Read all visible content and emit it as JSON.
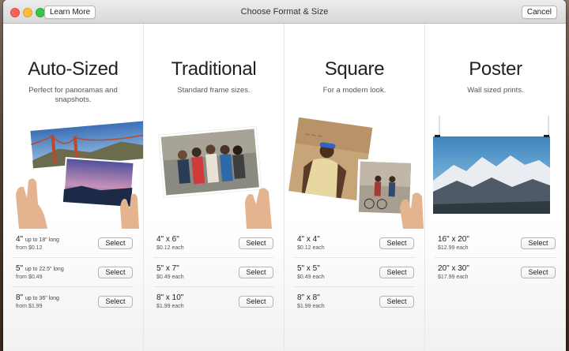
{
  "window": {
    "title": "Choose Format & Size",
    "learn_more_label": "Learn More",
    "cancel_label": "Cancel"
  },
  "columns": [
    {
      "title": "Auto-Sized",
      "subtitle": "Perfect for panoramas and snapshots.",
      "options": [
        {
          "size": "4\"",
          "size_note": "up to 18\" long",
          "price": "from $0.12",
          "button": "Select"
        },
        {
          "size": "5\"",
          "size_note": "up to 22.5\" long",
          "price": "from $0.49",
          "button": "Select"
        },
        {
          "size": "8\"",
          "size_note": "up to 36\" long",
          "price": "from $1.99",
          "button": "Select"
        }
      ]
    },
    {
      "title": "Traditional",
      "subtitle": "Standard frame sizes.",
      "options": [
        {
          "size": "4\" x 6\"",
          "price": "$0.12 each",
          "button": "Select"
        },
        {
          "size": "5\" x 7\"",
          "price": "$0.49 each",
          "button": "Select"
        },
        {
          "size": "8\" x 10\"",
          "price": "$1.99 each",
          "button": "Select"
        }
      ]
    },
    {
      "title": "Square",
      "subtitle": "For a modern look.",
      "options": [
        {
          "size": "4\" x 4\"",
          "price": "$0.12 each",
          "button": "Select"
        },
        {
          "size": "5\" x 5\"",
          "price": "$0.49 each",
          "button": "Select"
        },
        {
          "size": "8\" x 8\"",
          "price": "$1.99 each",
          "button": "Select"
        }
      ]
    },
    {
      "title": "Poster",
      "subtitle": "Wall sized prints.",
      "options": [
        {
          "size": "16\" x 20\"",
          "price": "$12.99 each",
          "button": "Select"
        },
        {
          "size": "20\" x 30\"",
          "price": "$17.99 each",
          "button": "Select"
        }
      ]
    }
  ]
}
